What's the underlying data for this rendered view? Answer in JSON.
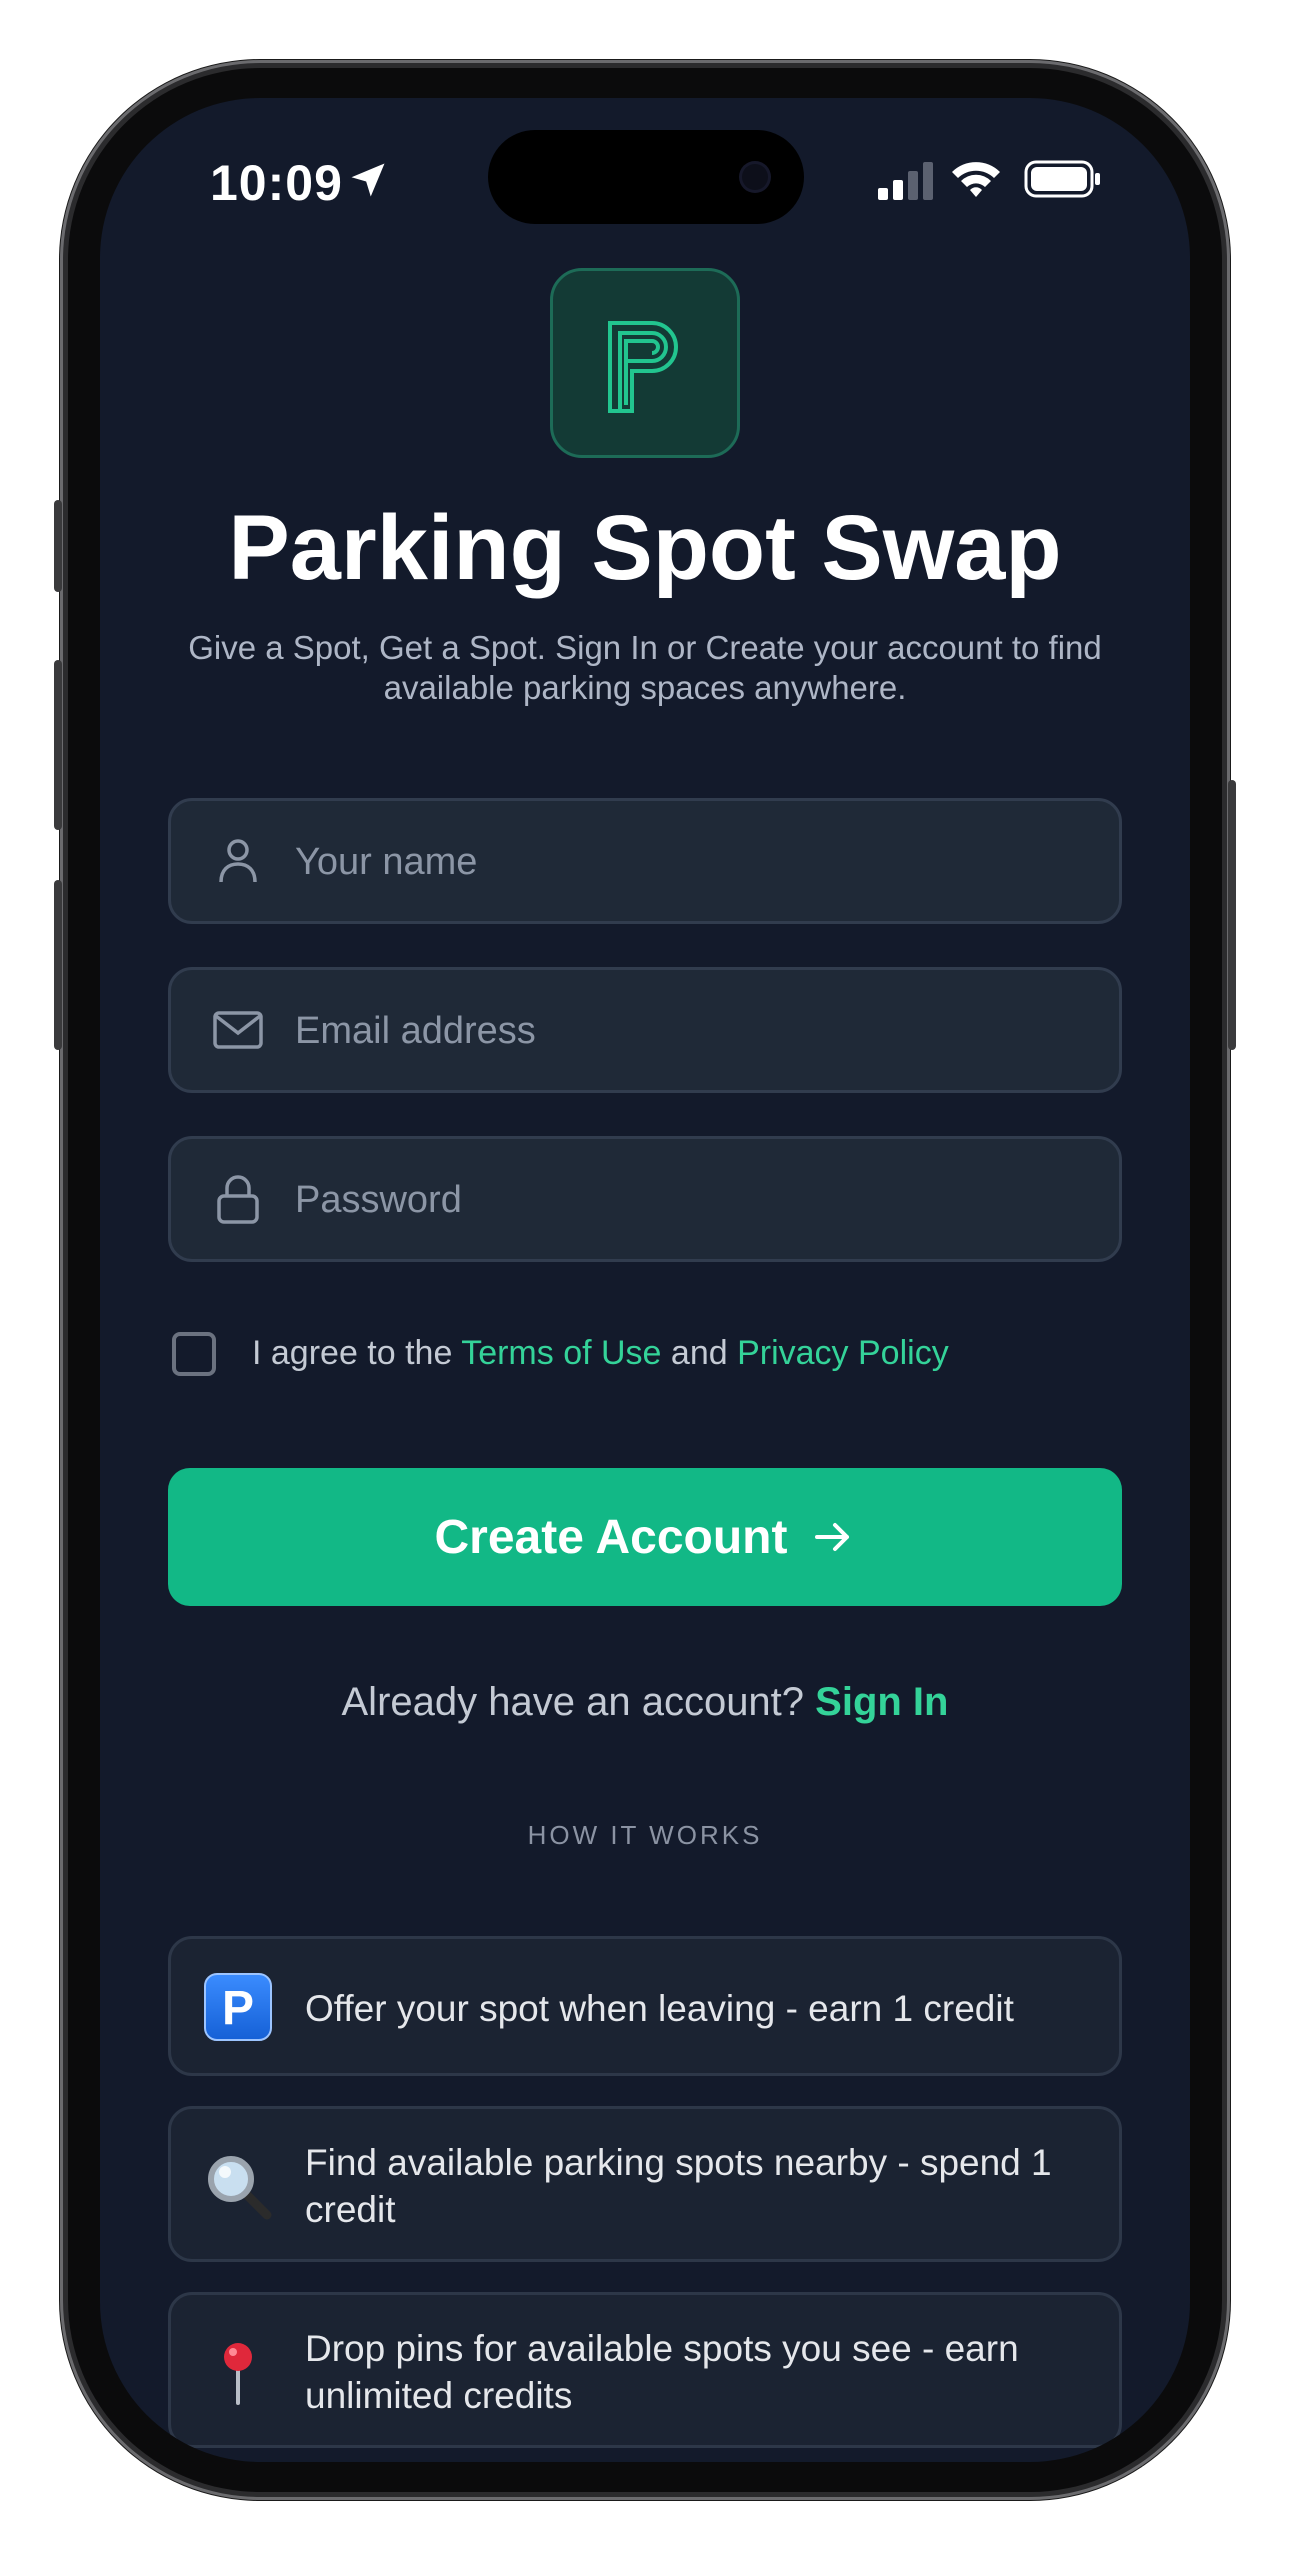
{
  "status_bar": {
    "time": "10:09"
  },
  "app": {
    "title": "Parking Spot Swap",
    "subtitle": "Give a Spot, Get a Spot. Sign In or Create your account to find available parking spaces anywhere.",
    "accent_color": "#12b886",
    "link_color": "#34d399",
    "background_color": "#131a2b"
  },
  "form": {
    "name_placeholder": "Your name",
    "name_value": "",
    "email_placeholder": "Email address",
    "email_value": "",
    "password_placeholder": "Password",
    "password_value": "",
    "agree_prefix": "I agree to the ",
    "terms_label": "Terms of Use",
    "agree_and": " and ",
    "privacy_label": "Privacy Policy",
    "agree_checked": false,
    "create_button_label": "Create Account"
  },
  "signin": {
    "prompt": "Already have an account? ",
    "link_label": "Sign In"
  },
  "how_it_works": {
    "heading": "HOW IT WORKS",
    "items": [
      {
        "icon": "parking-sign-icon",
        "text": "Offer your spot when leaving - earn 1 credit"
      },
      {
        "icon": "magnifying-glass-icon",
        "text": "Find available parking spots nearby - spend 1 credit"
      },
      {
        "icon": "pushpin-icon",
        "text": "Drop pins for available spots you see - earn unlimited credits"
      }
    ]
  }
}
